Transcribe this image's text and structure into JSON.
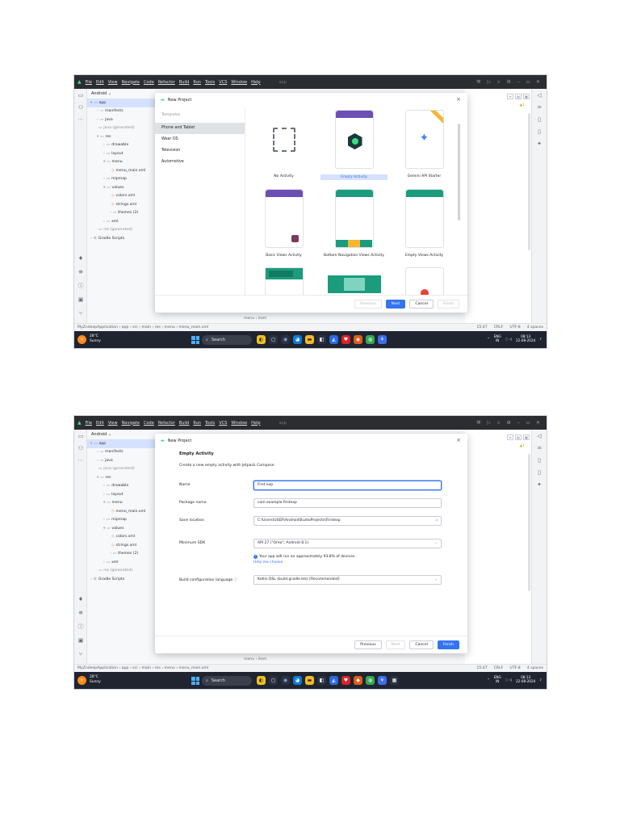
{
  "ide": {
    "menu": [
      "File",
      "Edit",
      "View",
      "Navigate",
      "Code",
      "Refactor",
      "Build",
      "Run",
      "Tools",
      "VCS",
      "Window",
      "Help"
    ],
    "breadcrumb_hint": "app",
    "project_view": "Android",
    "tree": [
      {
        "label": "app",
        "indent": 0,
        "glyph": "▾",
        "kind": "folder"
      },
      {
        "label": "manifests",
        "indent": 1,
        "glyph": "›",
        "kind": "folder"
      },
      {
        "label": "java",
        "indent": 1,
        "glyph": "›",
        "kind": "folder"
      },
      {
        "label": "java (generated)",
        "indent": 1,
        "glyph": " ",
        "kind": "folder-muted"
      },
      {
        "label": "res",
        "indent": 1,
        "glyph": "▾",
        "kind": "folder"
      },
      {
        "label": "drawable",
        "indent": 2,
        "glyph": "›",
        "kind": "folder"
      },
      {
        "label": "layout",
        "indent": 2,
        "glyph": "›",
        "kind": "folder"
      },
      {
        "label": "menu",
        "indent": 2,
        "glyph": "▾",
        "kind": "folder"
      },
      {
        "label": "menu_main.xml",
        "indent": 3,
        "glyph": " ",
        "kind": "xml"
      },
      {
        "label": "mipmap",
        "indent": 2,
        "glyph": "›",
        "kind": "folder"
      },
      {
        "label": "values",
        "indent": 2,
        "glyph": "▾",
        "kind": "folder"
      },
      {
        "label": "colors.xml",
        "indent": 3,
        "glyph": " ",
        "kind": "xml"
      },
      {
        "label": "strings.xml",
        "indent": 3,
        "glyph": " ",
        "kind": "xml"
      },
      {
        "label": "themes (2)",
        "indent": 3,
        "glyph": "›",
        "kind": "folder"
      },
      {
        "label": "xml",
        "indent": 2,
        "glyph": "›",
        "kind": "folder"
      },
      {
        "label": "res (generated)",
        "indent": 1,
        "glyph": " ",
        "kind": "folder-muted"
      },
      {
        "label": "Gradle Scripts",
        "indent": 0,
        "glyph": "›",
        "kind": "gradle"
      }
    ],
    "editor_bottom": "menu › item",
    "status_path": "MyZndeepApplication › app › src › main › res › menu › menu_main.xml",
    "status_right": [
      "15:47",
      "CRLF",
      "UTF-8",
      "4 spaces"
    ],
    "warning_count": "▲1"
  },
  "taskbar": {
    "weather_temp": "28°C",
    "weather_text": "Sunny",
    "search_placeholder": "Search",
    "lang_top": "ENG",
    "lang_bottom": "IN",
    "time": "08:13",
    "date": "22-08-2024"
  },
  "dialog1": {
    "title": "New Project",
    "templates_header": "Templates",
    "categories": [
      "Phone and Tablet",
      "Wear OS",
      "Television",
      "Automotive"
    ],
    "selected_category": 0,
    "cards": [
      {
        "label": "No Activity"
      },
      {
        "label": "Empty Activity",
        "selected": true
      },
      {
        "label": "Gemini API Starter"
      },
      {
        "label": "Basic Views Activity"
      },
      {
        "label": "Bottom Navigation Views Activity"
      },
      {
        "label": "Empty Views Activity"
      }
    ],
    "buttons": {
      "previous": "Previous",
      "next": "Next",
      "cancel": "Cancel",
      "finish": "Finish"
    }
  },
  "dialog2": {
    "title": "New Project",
    "heading": "Empty Activity",
    "subheading": "Create a new empty activity with Jetpack Compose",
    "fields": {
      "name_label": "Name",
      "name_value": "First exp",
      "package_label": "Package name",
      "package_value": "com.example.firstexp",
      "save_label": "Save location",
      "save_value": "C:\\Users\\USER\\AndroidStudioProjects\\Firstexp",
      "minsdk_label": "Minimum SDK",
      "minsdk_value": "API 27 (\"Oreo\"; Android 8.1)",
      "info_text": "Your app will run on approximately 93.8% of devices.",
      "help_link": "Help me choose",
      "build_label": "Build configuration language",
      "build_value": "Kotlin DSL (build.gradle.kts) [Recommended]"
    },
    "buttons": {
      "previous": "Previous",
      "next": "Next",
      "cancel": "Cancel",
      "finish": "Finish"
    }
  }
}
